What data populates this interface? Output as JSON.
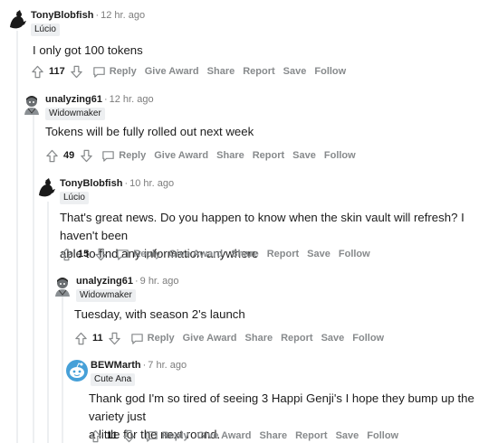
{
  "comments": [
    {
      "username": "TonyBlobfish",
      "time": "12 hr. ago",
      "flair": "Lúcio",
      "body": "I only got 100 tokens",
      "score": "117",
      "avatar": "black-silhouette-avatar-icon"
    },
    {
      "username": "unalyzing61",
      "time": "12 hr. ago",
      "flair": "Widowmaker",
      "body": "Tokens will be fully rolled out next week",
      "score": "49",
      "avatar": "gray-character-avatar-icon"
    },
    {
      "username": "TonyBlobfish",
      "time": "10 hr. ago",
      "flair": "Lúcio",
      "body_line1": "That's great news. Do you happen to know when the skin vault will refresh? I haven't been",
      "body_line2": "able to find any information anywhere",
      "score": "15",
      "avatar": "black-silhouette-avatar-icon"
    },
    {
      "username": "unalyzing61",
      "time": "9 hr. ago",
      "flair": "Widowmaker",
      "body": "Tuesday, with season 2's launch",
      "score": "11",
      "avatar": "gray-character-avatar-icon"
    },
    {
      "username": "BEWMarth",
      "time": "7 hr. ago",
      "flair": "Cute Ana",
      "body_line1": "Thank god I'm so tired of seeing 3 Happi Genji's I hope they bump up the variety just",
      "body_line2": "a little for the next round.",
      "score": "11",
      "avatar": "blue-snoo-avatar-icon"
    }
  ],
  "actions": {
    "reply": "Reply",
    "give_award": "Give Award",
    "share": "Share",
    "report": "Report",
    "save": "Save",
    "follow": "Follow",
    "separator": "·"
  },
  "colors": {
    "text": "#1c1c1c",
    "muted": "#878a8c",
    "flair_bg": "#edeff1",
    "snoo_blue": "#46a0d8"
  }
}
